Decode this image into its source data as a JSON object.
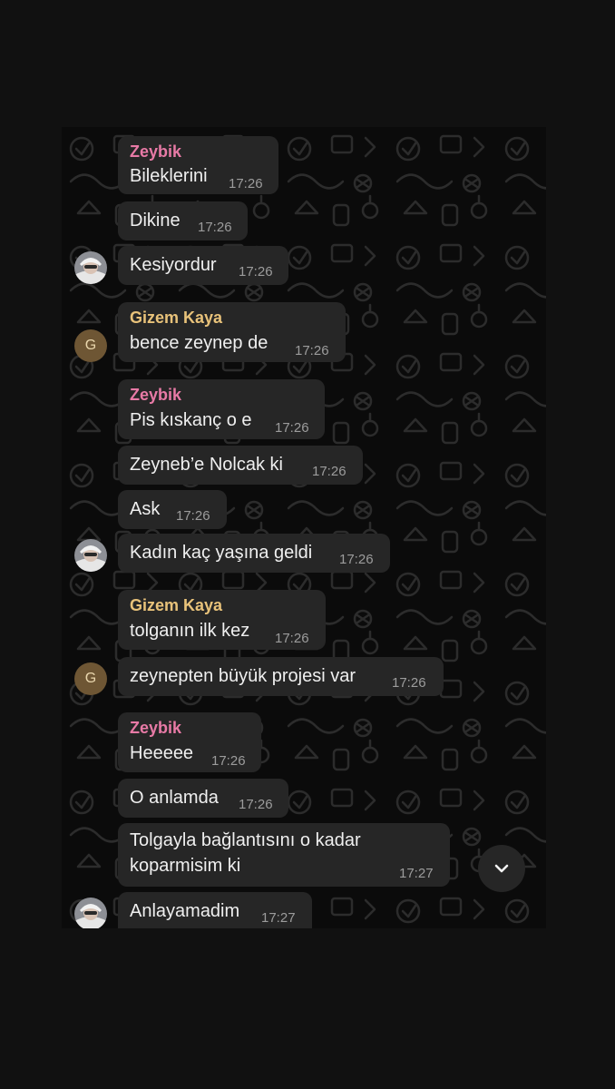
{
  "colors": {
    "zeybik": "#e87aa6",
    "gizem": "#e8c27a",
    "bubble": "#262626",
    "background": "#111111"
  },
  "messages": [
    {
      "sender": "Zeybik",
      "text": "Bileklerini",
      "time": "17:26"
    },
    {
      "text": "Dikine",
      "time": "17:26"
    },
    {
      "text": "Kesiyordur",
      "time": "17:26",
      "avatar": "photo"
    },
    {
      "sender": "Gizem Kaya",
      "text": "bence zeynep de",
      "time": "17:26",
      "avatar": "G"
    },
    {
      "sender": "Zeybik",
      "text": "Pis kıskanç o e",
      "time": "17:26"
    },
    {
      "text": "Zeyneb’e Nolcak ki",
      "time": "17:26"
    },
    {
      "text": "Ask",
      "time": "17:26"
    },
    {
      "text": "Kadın kaç yaşına geldi",
      "time": "17:26",
      "avatar": "photo"
    },
    {
      "sender": "Gizem Kaya",
      "text": "tolganın ilk kez",
      "time": "17:26"
    },
    {
      "text": "zeynepten büyük projesi var",
      "time": "17:26",
      "avatar": "G"
    },
    {
      "sender": "Zeybik",
      "text": "Heeeee",
      "time": "17:26"
    },
    {
      "text": "O anlamda",
      "time": "17:26"
    },
    {
      "text": "Tolgayla bağlantısını o kadar",
      "text2": "koparmisim ki",
      "time": "17:27"
    },
    {
      "text": "Anlayamadim",
      "time": "17:27",
      "avatar": "photo"
    }
  ],
  "icons": {
    "scroll_down": "chevron-down-icon",
    "wallpaper": "doodle-pattern"
  }
}
